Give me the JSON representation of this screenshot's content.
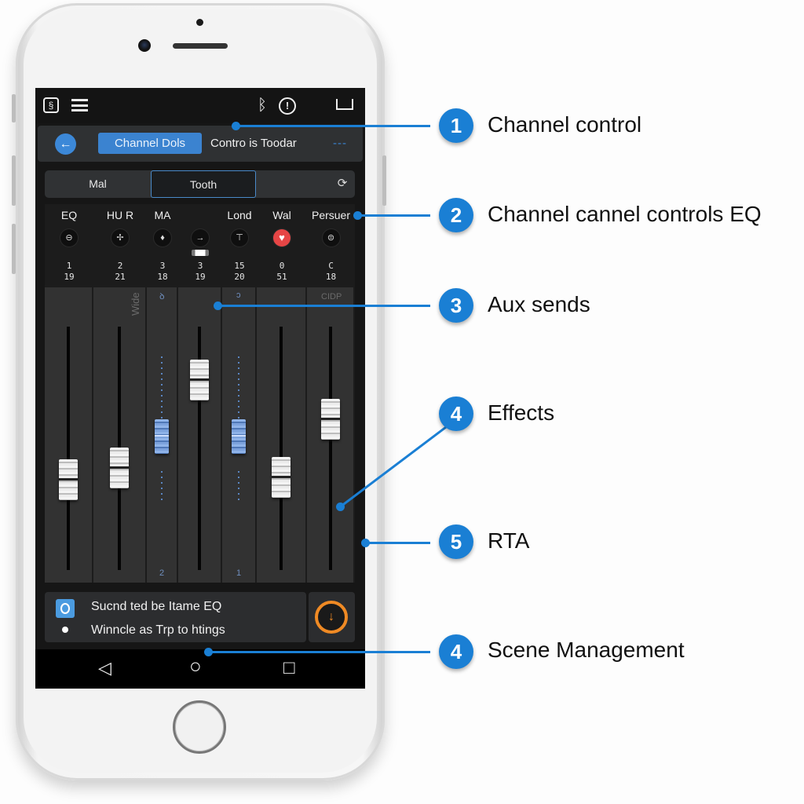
{
  "status_bar": {
    "left_icons": [
      "app-logo-icon",
      "hamburger-menu-icon"
    ],
    "right_icons": [
      "bluetooth-icon",
      "alert-icon",
      "battery-icon"
    ]
  },
  "toolbar": {
    "back_icon": "←",
    "active_tab": "Channel Dols",
    "label": "Contro is Toodar",
    "more": "---"
  },
  "segment": {
    "items": [
      "Mal",
      "Tooth"
    ],
    "active": "Tooth",
    "icon": "⟳"
  },
  "channels": [
    {
      "name": "EQ",
      "knob": "⊖",
      "num1": "1",
      "num2": "19",
      "fader_level": 0.37,
      "type": "white"
    },
    {
      "name": "HU R",
      "knob": "✢",
      "num1": "2",
      "num2": "21",
      "fader_level": 0.42,
      "type": "white",
      "strip_label": "Wide"
    },
    {
      "name": "MA",
      "knob": "♦",
      "num1": "3",
      "num2": "18",
      "fader_level": 0.55,
      "type": "blue",
      "top_mark": "ꝺ",
      "bottom_mark": "2"
    },
    {
      "name": "",
      "knob": "→",
      "num1": "3",
      "num2": "19",
      "fader_level": 0.78,
      "type": "white",
      "mini_toggle": true
    },
    {
      "name": "Lond",
      "knob": "⊤",
      "num1": "15",
      "num2": "20",
      "fader_level": 0.55,
      "type": "blue",
      "top_mark": "ɔ",
      "bottom_mark": "1"
    },
    {
      "name": "Wal",
      "knob": "♥",
      "num1": "0",
      "num2": "51",
      "fader_level": 0.38,
      "type": "white",
      "knob_active": true
    },
    {
      "name": "Persuer",
      "knob": "⊜",
      "num1": "C",
      "num2": "18",
      "fader_level": 0.62,
      "type": "white",
      "strip_label": "CIDP"
    }
  ],
  "scene": {
    "line1": "Sucnd ted be Itame EQ",
    "line2": "Winncle as Trp to htings",
    "download_icon": "↓"
  },
  "navbar": {
    "back": "◁",
    "home": "○",
    "recents": "□"
  },
  "callouts": [
    {
      "number": "1",
      "label": "Channel control"
    },
    {
      "number": "2",
      "label": "Channel cannel controls EQ"
    },
    {
      "number": "3",
      "label": "Aux sends"
    },
    {
      "number": "4",
      "label": "Effects"
    },
    {
      "number": "5",
      "label": "RTA"
    },
    {
      "number": "4",
      "label": "Scene Management"
    }
  ],
  "colors": {
    "accent": "#1a7fd4",
    "active_tab": "#3b83d0",
    "warning": "#f08a24",
    "heart": "#e64545"
  }
}
